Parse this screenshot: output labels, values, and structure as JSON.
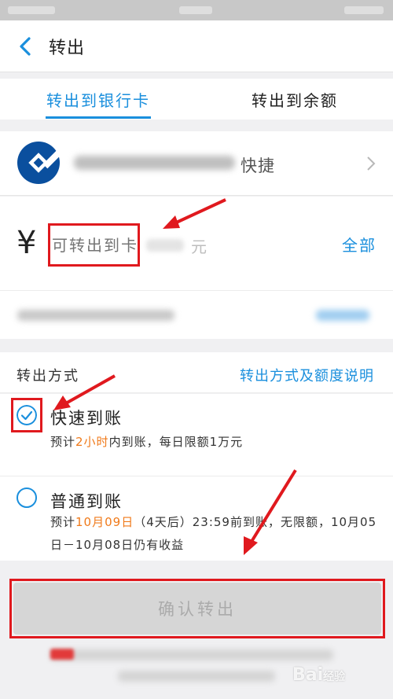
{
  "nav": {
    "title": "转出"
  },
  "tabs": [
    {
      "label": "转出到银行卡",
      "active": true
    },
    {
      "label": "转出到余额",
      "active": false
    }
  ],
  "card": {
    "suffix": "快捷",
    "icon": "ccb-bank-logo"
  },
  "amount": {
    "currency_symbol": "¥",
    "placeholder": "可转出到卡",
    "unit": "元",
    "all_label": "全部"
  },
  "method": {
    "label": "转出方式",
    "help_link": "转出方式及额度说明",
    "options": [
      {
        "title": "快速到账",
        "desc_prefix": "预计",
        "desc_highlight": "2小时",
        "desc_suffix": "内到账，每日限额1万元",
        "selected": true
      },
      {
        "title": "普通到账",
        "desc_prefix": "预计",
        "desc_highlight": "10月09日",
        "desc_suffix": "（4天后）23:59前到账，无限额，10月05日－10月08日仍有收益",
        "selected": false
      }
    ]
  },
  "confirm": {
    "label": "确认转出"
  },
  "watermark": {
    "text": "Bai",
    "suffix": "经验"
  },
  "colors": {
    "accent": "#1a8fdd",
    "highlight": "#f07a1a",
    "annotation": "#e0191e"
  }
}
